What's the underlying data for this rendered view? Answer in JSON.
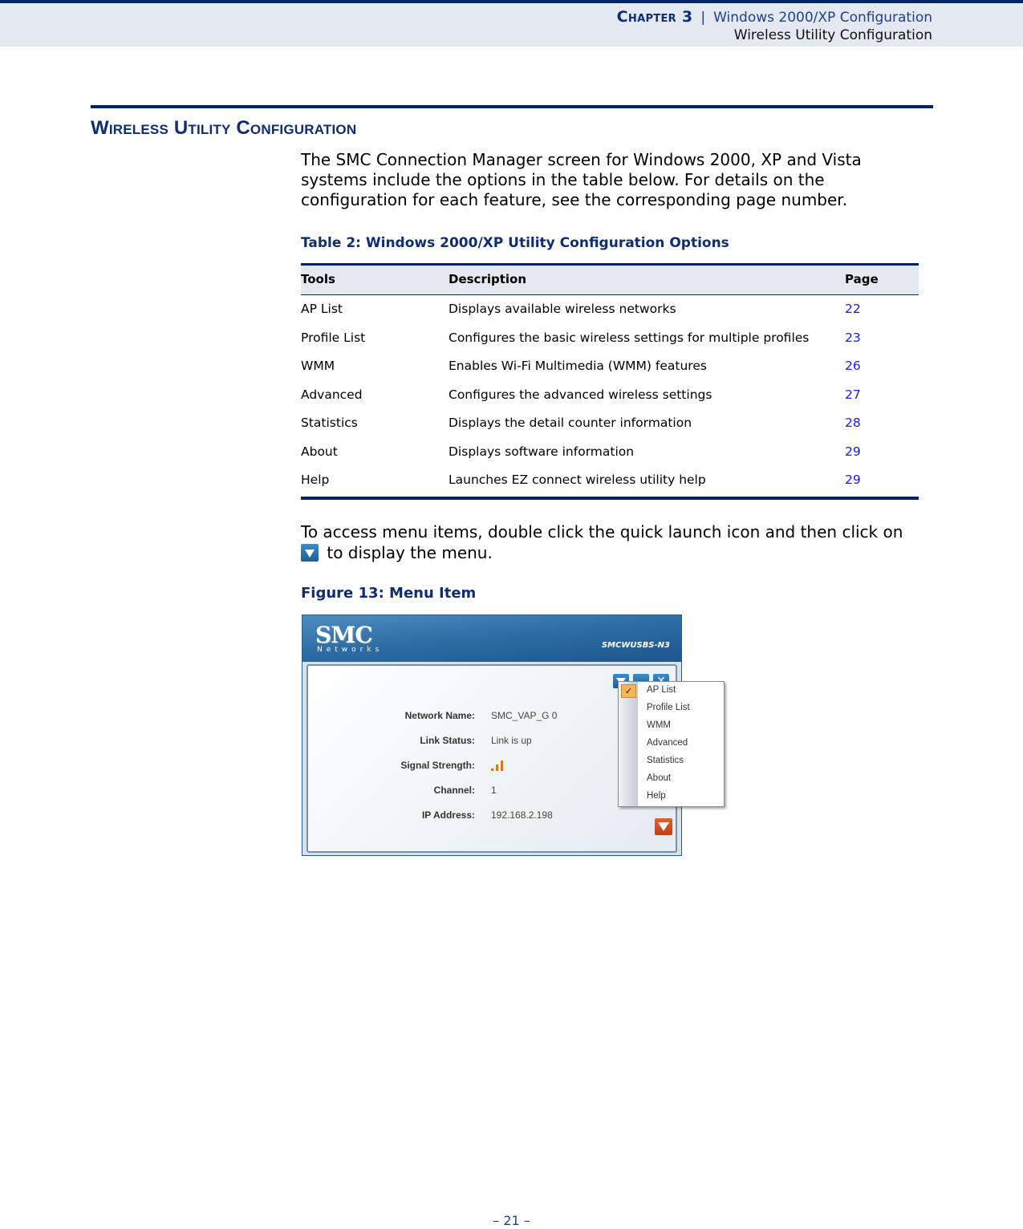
{
  "header": {
    "chapter": "Chapter 3",
    "separator": "|",
    "chapter_title": "Windows 2000/XP Configuration",
    "section": "Wireless Utility Configuration"
  },
  "section_title": "Wireless Utility Configuration",
  "intro": "The SMC Connection Manager screen for Windows 2000, XP and Vista systems include the options in the table below. For details on the configuration for each feature, see the corresponding page number.",
  "table": {
    "caption": "Table 2: Windows 2000/XP Utility Configuration Options",
    "headers": [
      "Tools",
      "Description",
      "Page"
    ],
    "rows": [
      {
        "tool": "AP List",
        "description": "Displays available wireless networks",
        "page": "22"
      },
      {
        "tool": "Profile List",
        "description": "Configures the basic wireless settings for multiple profiles",
        "page": "23"
      },
      {
        "tool": "WMM",
        "description": "Enables Wi-Fi Multimedia (WMM) features",
        "page": "26"
      },
      {
        "tool": "Advanced",
        "description": "Configures the advanced wireless settings",
        "page": "27"
      },
      {
        "tool": "Statistics",
        "description": "Displays the detail counter information",
        "page": "28"
      },
      {
        "tool": "About",
        "description": "Displays software information",
        "page": "29"
      },
      {
        "tool": "Help",
        "description": "Launches EZ connect wireless utility help",
        "page": "29"
      }
    ]
  },
  "access": {
    "text_before": "To access menu items, double click the quick launch icon and then click on",
    "icon": "menu-down-arrow-icon",
    "text_after": "to display the menu."
  },
  "figure": {
    "caption": "Figure 13:  Menu Item",
    "app": {
      "logo": "SMC",
      "logo_sub": "Networks",
      "model": "SMCWUSBS-N3",
      "close_glyph": "✕",
      "fields": [
        {
          "label": "Network Name:",
          "value": "SMC_VAP_G 0"
        },
        {
          "label": "Link Status:",
          "value": "Link is up"
        },
        {
          "label": "Signal Strength:",
          "value": "",
          "signal_bars_lit": 3
        },
        {
          "label": "Channel:",
          "value": "1"
        },
        {
          "label": "IP Address:",
          "value": "192.168.2.198"
        }
      ],
      "menu": {
        "checked_item": "AP List",
        "check_glyph": "✓",
        "items": [
          "AP List",
          "Profile List",
          "WMM",
          "Advanced",
          "Statistics",
          "About",
          "Help"
        ]
      }
    }
  },
  "footer": {
    "page_number": "–  21  –"
  },
  "colors": {
    "navy": "#00236a",
    "header_bg": "#e4e8f1",
    "link": "#1a1aee",
    "accent_orange": "#e0761a"
  }
}
